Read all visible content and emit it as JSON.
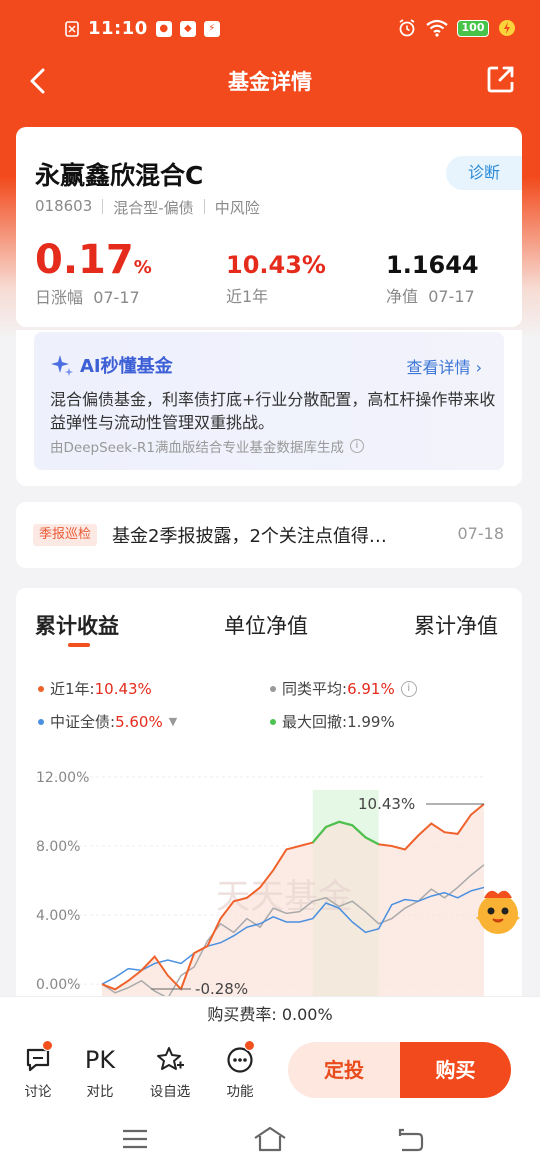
{
  "status_bar": {
    "time": "11:10",
    "battery": "100",
    "icons": [
      "message-icon",
      "app-icon",
      "app-icon",
      "app-icon",
      "alarm-icon",
      "wifi-icon",
      "battery-icon",
      "charging-icon"
    ]
  },
  "nav": {
    "title": "基金详情"
  },
  "fund": {
    "name": "永赢鑫欣混合C",
    "diagnose_label": "诊断",
    "code": "018603",
    "type": "混合型-偏债",
    "risk": "中风险",
    "daily_change_value": "0.17",
    "daily_change_unit": "%",
    "daily_change_label": "日涨幅",
    "daily_change_date": "07-17",
    "year_return": "10.43%",
    "year_return_label": "近1年",
    "nav_value": "1.1644",
    "nav_label": "净值",
    "nav_date": "07-17"
  },
  "ai": {
    "title": "AI秒懂基金",
    "link": "查看详情",
    "text": "混合偏债基金，利率债打底+行业分散配置，高杠杆操作带来收益弹性与流动性管理双重挑战。",
    "footer": "由DeepSeek-R1满血版结合专业基金数据库生成"
  },
  "report": {
    "tag": "季报巡检",
    "text": "基金2季报披露，2个关注点值得…",
    "date": "07-18"
  },
  "chart_tabs": [
    "累计收益",
    "单位净值",
    "累计净值"
  ],
  "legend": {
    "fund_label": "近1年:",
    "fund_value": "10.43%",
    "peer_label": "同类平均:",
    "peer_value": "6.91%",
    "index_label": "中证全债:",
    "index_value": "5.60%",
    "drawdown_label": "最大回撤:",
    "drawdown_value": "1.99%"
  },
  "colors": {
    "fund": "#f0622b",
    "peer": "#aaaaaa",
    "index": "#4a8fe0",
    "drawdown": "#4cc250",
    "brand": "#f24a1c"
  },
  "chart_data": {
    "type": "line",
    "yticks": [
      "12.00%",
      "8.00%",
      "4.00%",
      "0.00%"
    ],
    "ylim": [
      -0.8,
      12.4
    ],
    "annotations": {
      "max_label": "10.43%",
      "min_label": "-0.28%"
    },
    "watermark": "天天基金",
    "series": [
      {
        "name": "近1年",
        "values": [
          0.0,
          -0.3,
          0.2,
          0.8,
          1.6,
          0.5,
          -0.28,
          1.8,
          2.2,
          3.8,
          4.8,
          5.0,
          5.6,
          6.6,
          7.8,
          8.0,
          8.2,
          9.1,
          9.4,
          9.2,
          8.5,
          8.1,
          8.0,
          7.8,
          8.6,
          9.3,
          8.8,
          8.7,
          9.8,
          10.43
        ]
      },
      {
        "name": "同类平均",
        "values": [
          0.0,
          -0.5,
          -0.2,
          0.2,
          -0.4,
          -0.8,
          0.5,
          1.0,
          2.5,
          3.5,
          3.0,
          3.8,
          3.3,
          4.4,
          4.1,
          4.2,
          4.8,
          5.0,
          4.5,
          4.8,
          4.2,
          3.5,
          3.8,
          4.4,
          4.8,
          5.5,
          5.0,
          5.6,
          6.3,
          6.91
        ]
      },
      {
        "name": "中证全债",
        "values": [
          0.0,
          0.4,
          0.9,
          0.8,
          1.2,
          1.4,
          1.2,
          1.8,
          2.2,
          2.4,
          2.8,
          3.3,
          3.5,
          3.9,
          3.6,
          3.6,
          3.8,
          4.7,
          4.4,
          3.6,
          3.0,
          3.2,
          4.6,
          4.9,
          4.8,
          5.1,
          5.3,
          5.0,
          5.4,
          5.6
        ]
      }
    ],
    "drawdown_range_index": [
      16,
      21
    ]
  },
  "fee": {
    "text": "购买费率: 0.00%"
  },
  "toolbar": {
    "discuss": "讨论",
    "pk_icon": "PK",
    "compare": "对比",
    "favorite": "设自选",
    "functions": "功能",
    "plan": "定投",
    "buy": "购买"
  }
}
